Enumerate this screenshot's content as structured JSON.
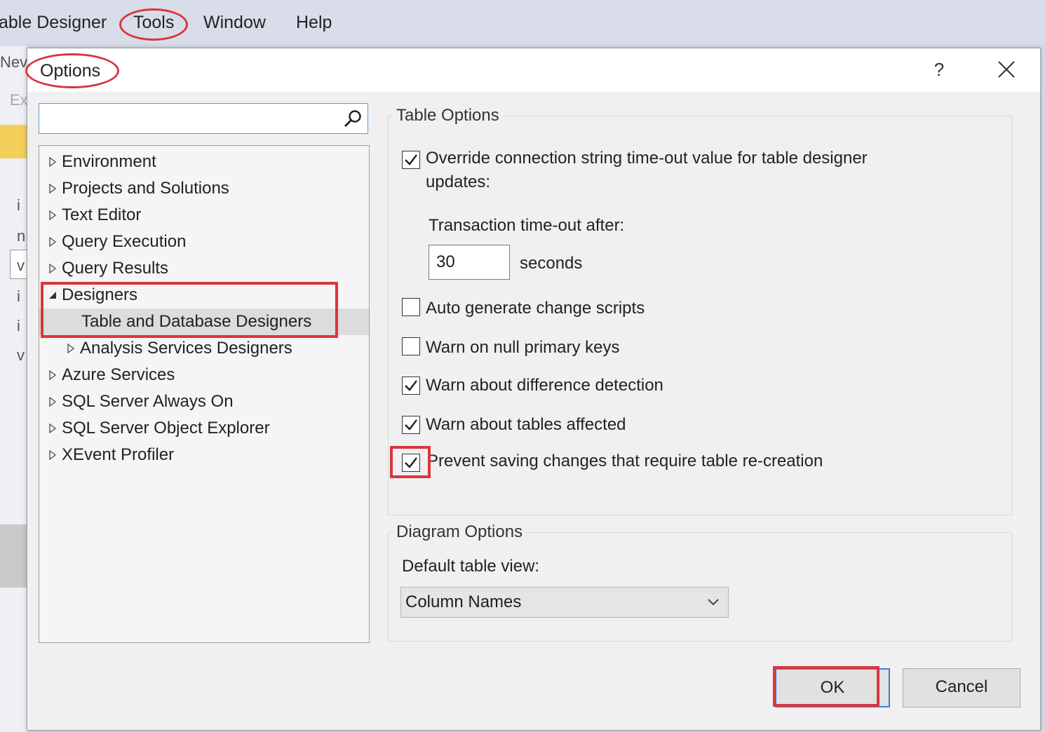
{
  "menubar": {
    "items": [
      "able Designer",
      "Tools",
      "Window",
      "Help"
    ]
  },
  "background": {
    "fragments": [
      "Nev",
      "Ex",
      "i",
      "n",
      "v",
      "i",
      "i",
      "v"
    ]
  },
  "dialog": {
    "title": "Options",
    "help_label": "?",
    "search": {
      "value": "",
      "placeholder": ""
    },
    "tree": [
      {
        "label": "Environment",
        "expanded": false
      },
      {
        "label": "Projects and Solutions",
        "expanded": false
      },
      {
        "label": "Text Editor",
        "expanded": false
      },
      {
        "label": "Query Execution",
        "expanded": false
      },
      {
        "label": "Query Results",
        "expanded": false
      },
      {
        "label": "Designers",
        "expanded": true
      },
      {
        "label": "Table and Database Designers",
        "selected": true
      },
      {
        "label": "Analysis Services Designers",
        "expanded": false
      },
      {
        "label": "Azure Services",
        "expanded": false
      },
      {
        "label": "SQL Server Always On",
        "expanded": false
      },
      {
        "label": "SQL Server Object Explorer",
        "expanded": false
      },
      {
        "label": "XEvent Profiler",
        "expanded": false
      }
    ],
    "table_options": {
      "title": "Table Options",
      "override_timeout": {
        "label": "Override connection string time-out value for table designer",
        "label_line2": "updates:",
        "checked": true
      },
      "transaction_timeout_label": "Transaction time-out after:",
      "transaction_timeout_value": "30",
      "seconds_label": "seconds",
      "auto_generate": {
        "label": "Auto generate change scripts",
        "checked": false
      },
      "warn_null_pk": {
        "label": "Warn on null primary keys",
        "checked": false
      },
      "warn_difference": {
        "label": "Warn about difference detection",
        "checked": true
      },
      "warn_tables": {
        "label": "Warn about tables affected",
        "checked": true
      },
      "prevent_saving": {
        "label": "Prevent saving changes that require table re-creation",
        "checked": true
      }
    },
    "diagram_options": {
      "title": "Diagram Options",
      "default_view_label": "Default table view:",
      "default_view_value": "Column Names"
    },
    "buttons": {
      "ok": "OK",
      "cancel": "Cancel"
    }
  },
  "colors": {
    "annotation_red": "#d9363e",
    "focus_blue": "#3c7fd9"
  }
}
